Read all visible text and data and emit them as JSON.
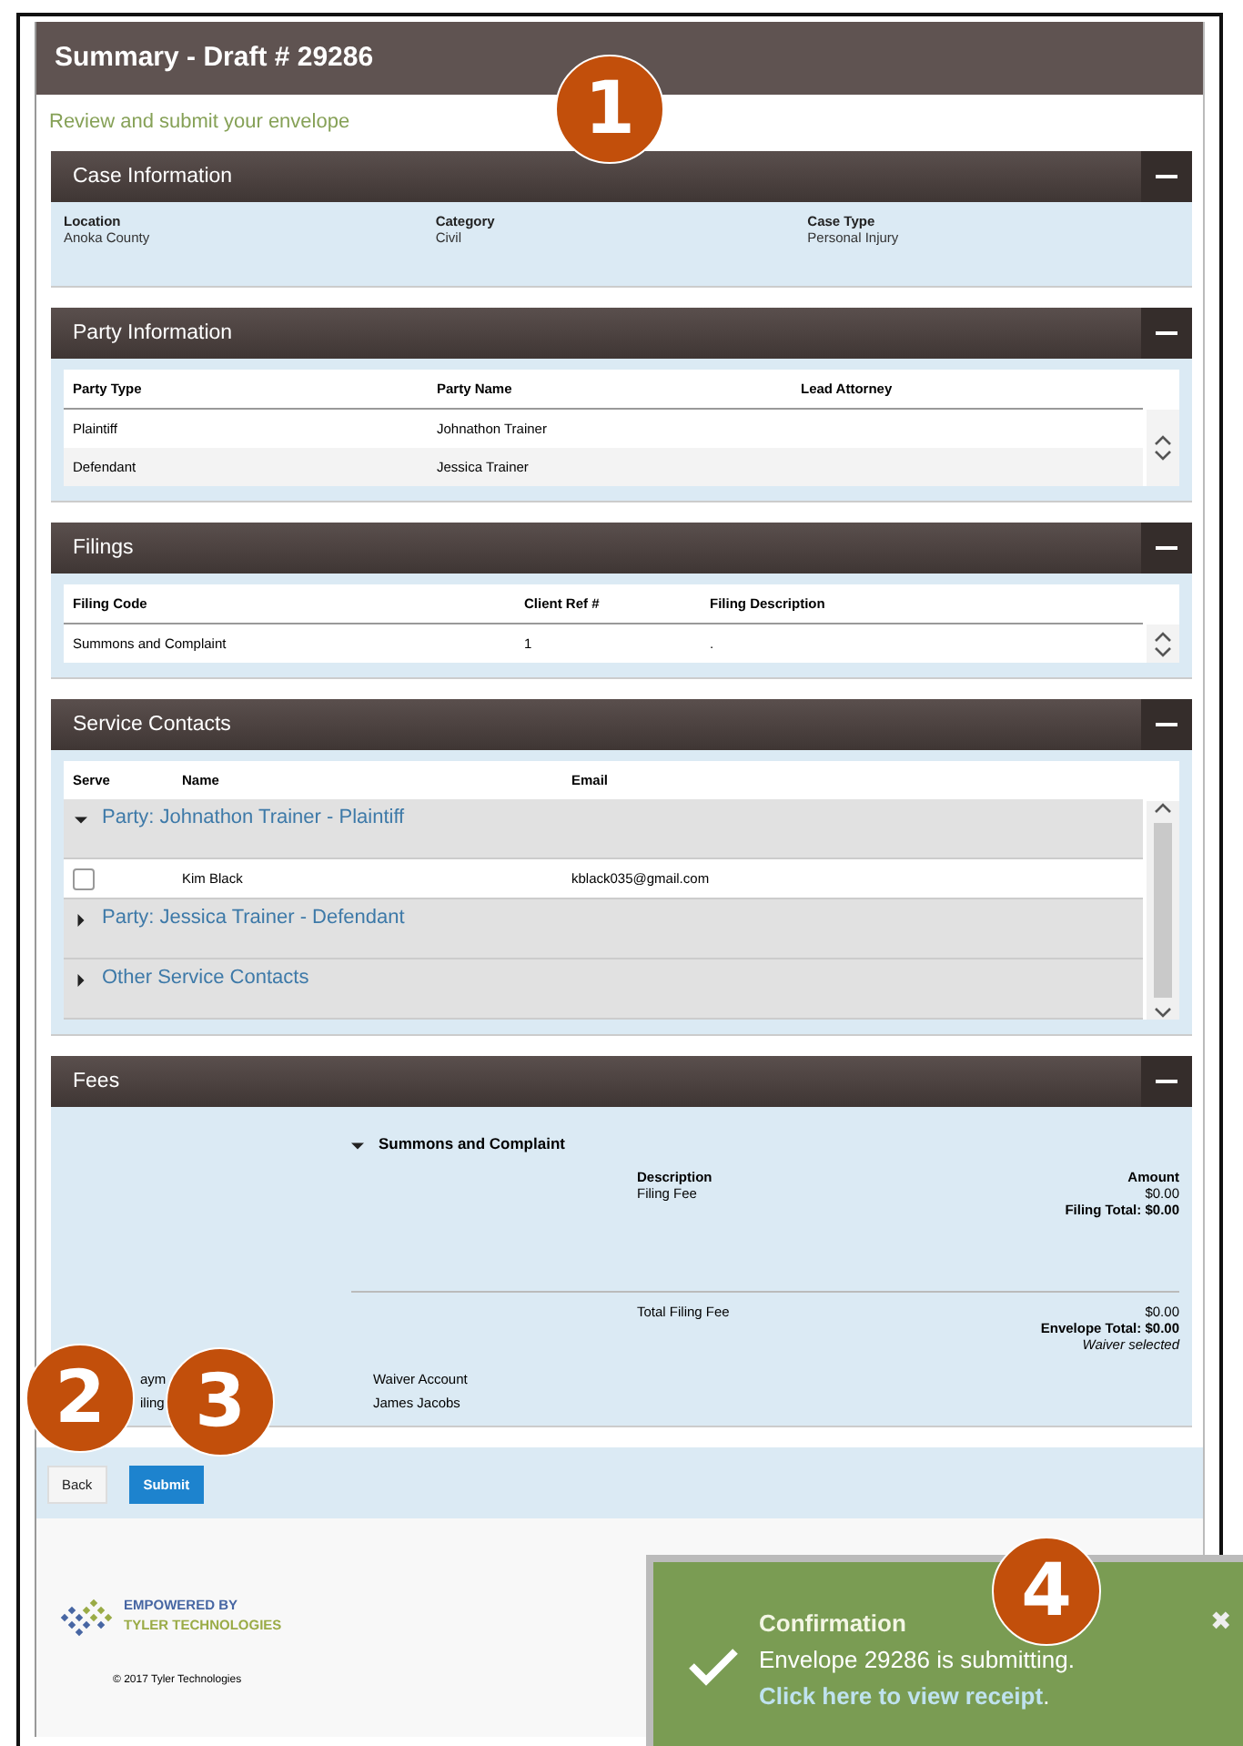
{
  "page": {
    "title": "Summary - Draft # 29286",
    "subtitle": "Review and submit your envelope"
  },
  "case_information": {
    "title": "Case Information",
    "fields": [
      {
        "label": "Location",
        "value": "Anoka County"
      },
      {
        "label": "Category",
        "value": "Civil"
      },
      {
        "label": "Case Type",
        "value": "Personal Injury"
      }
    ]
  },
  "party_information": {
    "title": "Party Information",
    "columns": [
      "Party Type",
      "Party Name",
      "Lead Attorney"
    ],
    "rows": [
      [
        "Plaintiff",
        "Johnathon Trainer",
        ""
      ],
      [
        "Defendant",
        "Jessica Trainer",
        ""
      ]
    ]
  },
  "filings": {
    "title": "Filings",
    "columns": [
      "Filing Code",
      "Client Ref #",
      "Filing Description"
    ],
    "rows": [
      [
        "Summons and Complaint",
        "1",
        "."
      ]
    ]
  },
  "service_contacts": {
    "title": "Service Contacts",
    "columns": [
      "Serve",
      "Name",
      "Email"
    ],
    "groups": [
      {
        "label": "Party: Johnathon Trainer - Plaintiff",
        "expanded": true,
        "contacts": [
          {
            "name": "Kim Black",
            "email": "kblack035@gmail.com",
            "checked": false
          }
        ]
      },
      {
        "label": "Party: Jessica Trainer - Defendant",
        "expanded": false
      },
      {
        "label": "Other Service Contacts",
        "expanded": false
      }
    ]
  },
  "fees": {
    "title": "Fees",
    "filing": {
      "name": "Summons and Complaint",
      "expanded": true,
      "description_header": "Description",
      "amount_header": "Amount",
      "items": [
        {
          "description": "Filing Fee",
          "amount": "$0.00"
        }
      ],
      "total": "Filing Total: $0.00"
    },
    "total_label": "Total Filing Fee",
    "total_amount": "$0.00",
    "envelope_total": "Envelope Total: $0.00",
    "waiver_note": "Waiver selected",
    "details": [
      {
        "label": "aym",
        "value": "Waiver Account"
      },
      {
        "label": "iling",
        "value": "James Jacobs"
      }
    ]
  },
  "buttons": [
    {
      "label": "Back",
      "kind": "secondary"
    },
    {
      "label": "Submit",
      "kind": "primary"
    }
  ],
  "footer": {
    "logo_line_1": "EMPOWERED BY",
    "logo_line_2": "TYLER TECHNOLOGIES",
    "copyright": "© 2017 Tyler Technologies"
  },
  "toast": {
    "title": "Confirmation",
    "message": "Envelope 29286 is submitting.",
    "link": "Click here to view receipt",
    "link_suffix": ".",
    "close": "✖"
  },
  "callouts": [
    "1",
    "2",
    "3",
    "4"
  ]
}
